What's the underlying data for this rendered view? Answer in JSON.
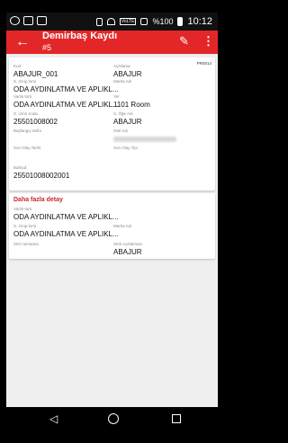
{
  "status": {
    "volte": "VoLTE",
    "battery": "%100",
    "time": "10:12"
  },
  "appbar": {
    "title": "Demirbaş Kaydı",
    "subtitle": "#5"
  },
  "card1": {
    "badge": "PR0014",
    "fields": {
      "kod_label": "Kod",
      "kod_value": "ABAJUR_001",
      "aciklama_label": "Açıklama",
      "aciklama_value": "ABAJUR",
      "sgrup_label": "S. Grup İsmi",
      "sgrup_value": "ODA AYDINLATMA VE APLIKL...",
      "marka_label": "Marka Adı",
      "varlik_label": "Varlık türü",
      "varlik_value": "ODA AYDINLATMA VE APLIKL...",
      "yer_label": "Yer",
      "yer_value": "1101 Room",
      "urun_label": "S. Ürün Kodu",
      "urun_value": "25501008002",
      "oge_label": "S. Öğe Adı",
      "oge_value": "ABAJUR",
      "baslangic_label": "Başlangıç tarihi",
      "otel_label": "Otel Adı",
      "sonolay_label": "Son Olay Tarihi",
      "sonolaytipi_label": "Son Olay Tipi",
      "barkod_label": "Barkod",
      "barkod_value": "25501008002001"
    }
  },
  "card2": {
    "title": "Daha fazla detay",
    "varlik_label": "Varlık türü",
    "varlik_value": "ODA AYDINLATMA VE APLIKL...",
    "sgrup_label": "S. Grup İsmi",
    "sgrup_value": "ODA AYDINLATMA VE APLIKL...",
    "marka_label": "Marka Adı",
    "seri_label": "Seri numarası",
    "stok_label": "Stok Açıklaması",
    "stok_value": "ABAJUR"
  },
  "colors": {
    "accent": "#e32728",
    "section_title": "#c62828"
  }
}
